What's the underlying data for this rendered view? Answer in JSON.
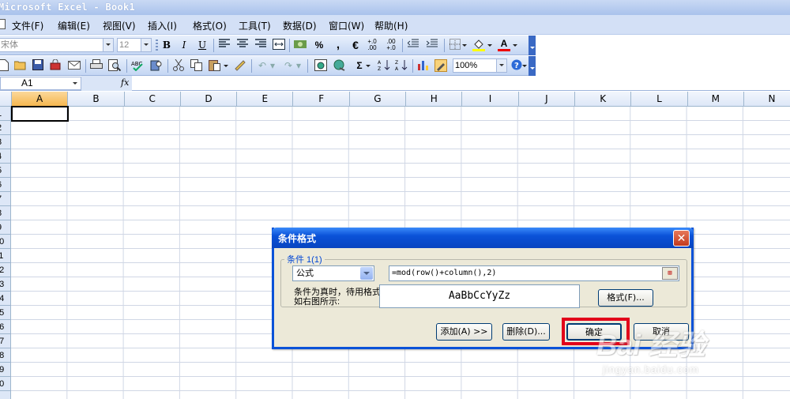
{
  "window": {
    "title": "Microsoft Excel - Book1"
  },
  "menu": [
    "文件(F)",
    "编辑(E)",
    "视图(V)",
    "插入(I)",
    "格式(O)",
    "工具(T)",
    "数据(D)",
    "窗口(W)",
    "帮助(H)"
  ],
  "format_toolbar": {
    "font_name": "宋体",
    "font_size": "12",
    "bold": "B",
    "italic": "I",
    "underline": "U",
    "percent": "%",
    "comma": ",",
    "euro": "€",
    "inc_decimal": "+.0\n.00",
    "dec_decimal": ".00\n+.0",
    "font_color_letter": "A"
  },
  "standard_toolbar": {
    "zoom": "100%",
    "sum": "Σ"
  },
  "formula_bar": {
    "name_box": "A1",
    "fx": "fx",
    "content": ""
  },
  "sheet": {
    "columns": [
      "A",
      "B",
      "C",
      "D",
      "E",
      "F",
      "G",
      "H",
      "I",
      "J",
      "K",
      "L",
      "M",
      "N"
    ],
    "row_labels": [
      "1",
      "2",
      "3",
      "4",
      "5",
      "6",
      "7",
      "8",
      "9",
      "10",
      "11",
      "12",
      "13",
      "14",
      "15",
      "16",
      "17",
      "18",
      "19",
      "20"
    ],
    "active_cell": "A1"
  },
  "dialog": {
    "title": "条件格式",
    "close": "✕",
    "group_label": "条件 1(1)",
    "condition_type": "公式",
    "formula": "=mod(row()+column(),2)",
    "pick_icon": "⊞",
    "condition_note": "条件为真时，待用格式如右图所示:",
    "preview": "AaBbCcYyZz",
    "format_button": "格式(F)...",
    "add_button": "添加(A) >>",
    "delete_button": "删除(D)...",
    "ok_button": "确定",
    "cancel_button": "取消"
  },
  "watermark": {
    "logo": "Bai 经验",
    "url": "jingyan.baidu.com"
  },
  "colors": {
    "title_blue": "#0a52d8",
    "highlight_red": "#e2001a",
    "selected_header": "#f5b54c"
  }
}
